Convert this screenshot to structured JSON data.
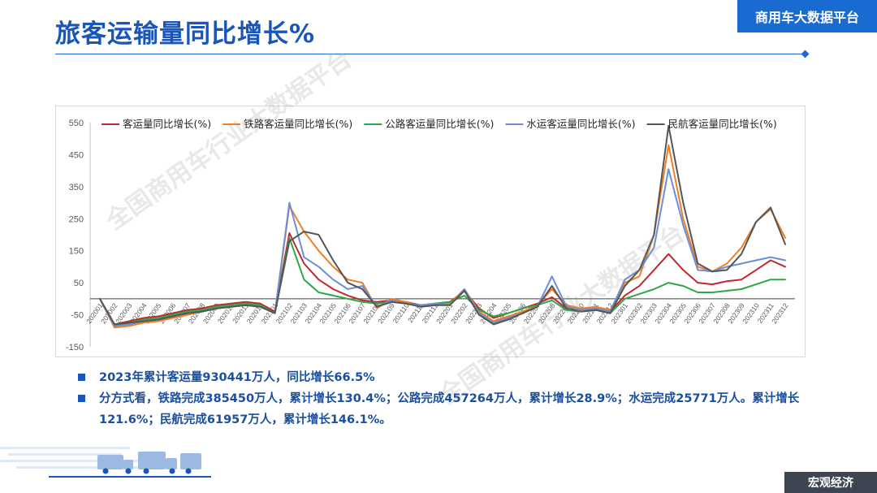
{
  "header": {
    "title": "旅客运输量同比增长%",
    "brand": "商用车大数据平台"
  },
  "footer": {
    "tag": "宏观经济"
  },
  "watermark": {
    "text": "全国商用车行业大数据平台"
  },
  "bullets": [
    "2023年累计客运量930441万人，同比增长66.5%",
    "分方式看，铁路完成385450万人，累计增长130.4%；公路完成457264万人，累计增长28.9%；水运完成25771万人。累计增长121.6%；民航完成61957万人，累计增长146.1%。"
  ],
  "chart_data": {
    "type": "line",
    "ylim": [
      -150,
      550
    ],
    "yticks": [
      -150,
      -50,
      50,
      150,
      250,
      350,
      450,
      550
    ],
    "grid": false,
    "legend_position": "top",
    "x": [
      "202001",
      "202002",
      "202003",
      "202004",
      "202005",
      "202006",
      "202007",
      "202008",
      "202009",
      "202010",
      "202011",
      "202012",
      "202101",
      "202102",
      "202103",
      "202104",
      "202105",
      "202106",
      "202107",
      "202108",
      "202109",
      "202110",
      "202111",
      "202112",
      "202201",
      "202202",
      "202203",
      "202204",
      "202205",
      "202206",
      "202207",
      "202208",
      "202209",
      "202210",
      "202211",
      "202212",
      "202301",
      "202302",
      "202303",
      "202304",
      "202305",
      "202306",
      "202307",
      "202308",
      "202309",
      "202310",
      "202311",
      "202312"
    ],
    "series": [
      {
        "name": "客运量同比增长(%)",
        "color": "#c0282d",
        "values": [
          0,
          -80,
          -70,
          -60,
          -55,
          -45,
          -35,
          -30,
          -20,
          -15,
          -10,
          -15,
          -40,
          205,
          110,
          60,
          30,
          10,
          -5,
          -10,
          -5,
          -10,
          -20,
          -15,
          -10,
          25,
          -30,
          -60,
          -45,
          -30,
          -15,
          5,
          -30,
          -35,
          -30,
          -40,
          10,
          40,
          90,
          140,
          90,
          50,
          45,
          55,
          60,
          90,
          120,
          100
        ]
      },
      {
        "name": "铁路客运量同比增长(%)",
        "color": "#f07f22",
        "values": [
          0,
          -90,
          -85,
          -75,
          -70,
          -60,
          -50,
          -40,
          -30,
          -25,
          -20,
          -25,
          -45,
          290,
          210,
          150,
          100,
          60,
          50,
          -30,
          0,
          -10,
          -25,
          -20,
          -15,
          30,
          -40,
          -70,
          -55,
          -40,
          -20,
          30,
          -20,
          -30,
          -25,
          -35,
          50,
          70,
          200,
          480,
          250,
          100,
          85,
          110,
          160,
          240,
          280,
          190
        ]
      },
      {
        "name": "公路客运量同比增长(%)",
        "color": "#2aa84a",
        "values": [
          0,
          -85,
          -75,
          -65,
          -60,
          -50,
          -40,
          -35,
          -25,
          -20,
          -15,
          -20,
          -45,
          190,
          60,
          20,
          10,
          0,
          -10,
          -15,
          -10,
          -15,
          -20,
          -15,
          -10,
          10,
          -35,
          -55,
          -45,
          -30,
          -20,
          -5,
          -35,
          -40,
          -35,
          -45,
          0,
          15,
          30,
          50,
          40,
          20,
          20,
          25,
          30,
          45,
          60,
          60
        ]
      },
      {
        "name": "水运客运量同比增长(%)",
        "color": "#6a8fd6",
        "values": [
          0,
          -85,
          -80,
          -70,
          -65,
          -55,
          -45,
          -40,
          -30,
          -25,
          -20,
          -25,
          -45,
          300,
          130,
          100,
          60,
          30,
          40,
          -25,
          -5,
          -15,
          -20,
          -15,
          -20,
          30,
          -45,
          -75,
          -60,
          -45,
          -25,
          70,
          -25,
          -35,
          -30,
          -40,
          60,
          90,
          160,
          405,
          230,
          90,
          85,
          100,
          110,
          120,
          130,
          120
        ]
      },
      {
        "name": "民航客运量同比增长(%)",
        "color": "#555555",
        "values": [
          0,
          -80,
          -75,
          -70,
          -65,
          -55,
          -45,
          -40,
          -30,
          -25,
          -20,
          -25,
          -45,
          180,
          210,
          200,
          120,
          50,
          30,
          -25,
          -10,
          -15,
          -25,
          -20,
          -20,
          25,
          -50,
          -80,
          -65,
          -45,
          -25,
          40,
          -30,
          -40,
          -35,
          -45,
          40,
          90,
          200,
          540,
          300,
          110,
          85,
          90,
          140,
          240,
          285,
          170
        ]
      }
    ]
  }
}
